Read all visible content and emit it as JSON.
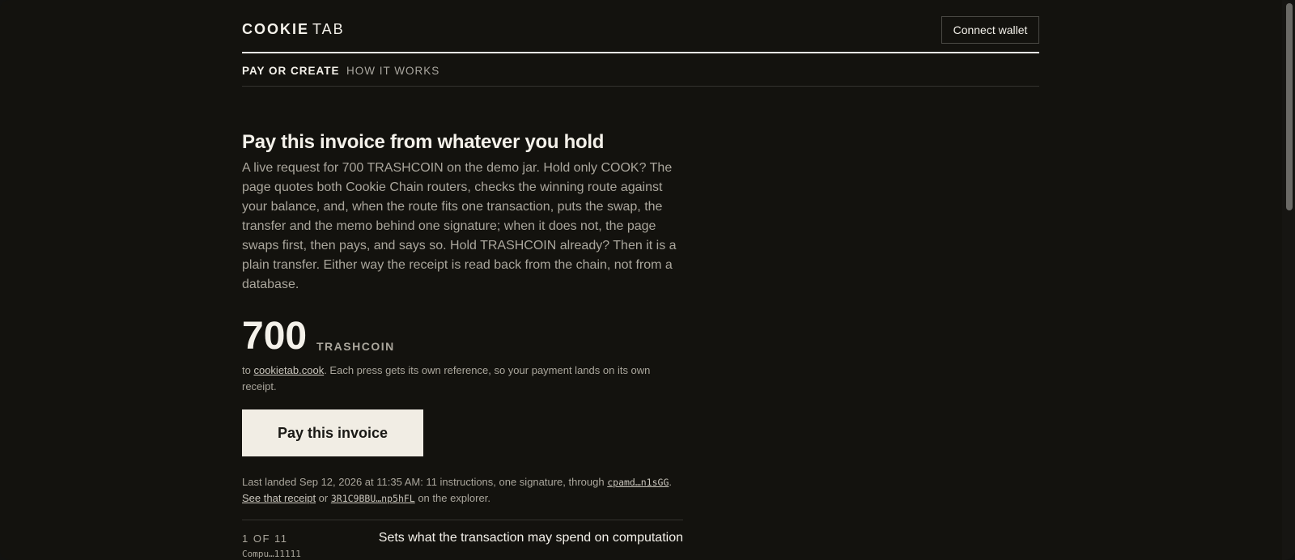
{
  "brand": {
    "bold": "COOKIE",
    "light": "TAB"
  },
  "header": {
    "wallet_button": "Connect wallet"
  },
  "nav": {
    "active": "PAY OR CREATE",
    "other": "HOW IT WORKS"
  },
  "invoice": {
    "title": "Pay this invoice from whatever you hold",
    "description": "A live request for 700 TRASHCOIN on the demo jar. Hold only COOK? The page quotes both Cookie Chain routers, checks the winning route against your balance, and, when the route fits one transaction, puts the swap, the transfer and the memo behind one signature; when it does not, the page swaps first, then pays, and says so. Hold TRASHCOIN already? Then it is a plain transfer. Either way the receipt is read back from the chain, not from a database.",
    "amount": "700",
    "unit": "TRASHCOIN",
    "to_prefix": "to ",
    "to_link": "cookietab.cook",
    "to_suffix": ". Each press gets its own reference, so your payment lands on its own receipt.",
    "pay_button": "Pay this invoice"
  },
  "last_landed": {
    "prefix": "Last landed Sep 12, 2026 at 11:35 AM: 11 instructions, one signature, through ",
    "router_code": "cpamd…n1sGG",
    "sep1": ". ",
    "receipt_link": "See that receipt",
    "or_text": " or ",
    "tx_code": "3R1C9BBU…np5hFL",
    "suffix": " on the explorer."
  },
  "steps": [
    {
      "count": "1 OF 11",
      "program": "Compu…11111",
      "description": "Sets what the transaction may spend on computation"
    }
  ]
}
